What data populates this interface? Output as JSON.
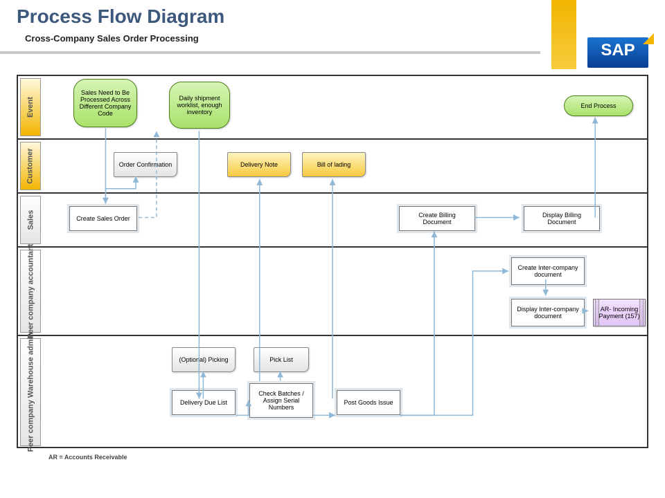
{
  "title": "Process Flow Diagram",
  "subtitle": "Cross-Company Sales Order Processing",
  "logo": "SAP",
  "footnote": "AR = Accounts Receivable",
  "lanes": {
    "event": "Event",
    "customer": "Customer",
    "sales": "Sales",
    "accountant": "Peer company accountant",
    "warehouse": "Peer company Warehouse admin"
  },
  "nodes": {
    "ev_start": "Sales Need to Be Processed Across Different Company Code",
    "ev_daily": "Daily shipment worklist, enough inventory",
    "ev_end": "End Process",
    "doc_orderconf": "Order Confirmation",
    "doc_delnote": "Delivery Note",
    "doc_bol": "Bill of lading",
    "p_cso": "Create Sales Order",
    "p_cbd": "Create Billing Document",
    "p_dbd": "Display Billing Document",
    "p_cic": "Create Inter-company document",
    "p_dic": "Display Inter-company document",
    "sub_ar": "AR- Incoming Payment (157)",
    "doc_optpick": "(Optional) Picking",
    "doc_picklist": "Pick List",
    "p_ddl": "Delivery Due List",
    "p_cbasn": "Check Batches / Assign Serial Numbers",
    "p_pgi": "Post Goods Issue"
  }
}
